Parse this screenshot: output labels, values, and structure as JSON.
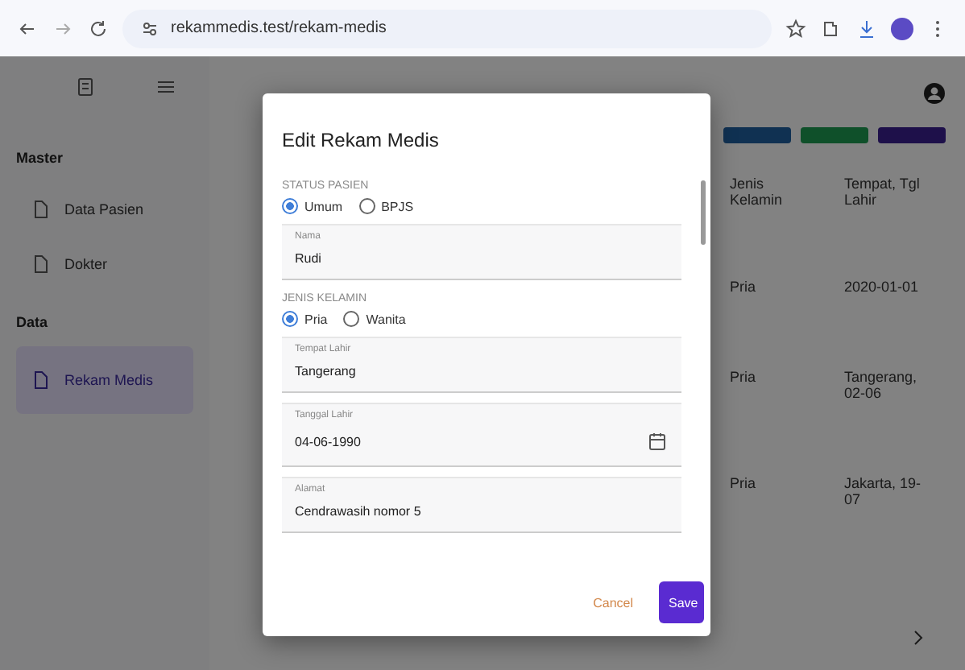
{
  "browser": {
    "url": "rekammedis.test/rekam-medis"
  },
  "sidebar": {
    "sections": [
      {
        "title": "Master",
        "items": [
          {
            "label": "Data Pasien",
            "selected": false
          },
          {
            "label": "Dokter",
            "selected": false
          }
        ]
      },
      {
        "title": "Data",
        "items": [
          {
            "label": "Rekam Medis",
            "selected": true
          }
        ]
      }
    ]
  },
  "table": {
    "columns": [
      "Jenis Kelamin",
      "Tempat, Tgl Lahir"
    ],
    "rows": [
      [
        "Pria",
        "2020-01-01"
      ],
      [
        "Pria",
        "Tangerang, 02-06"
      ],
      [
        "Pria",
        "Jakarta, 19-07"
      ]
    ]
  },
  "dialog": {
    "title": "Edit Rekam Medis",
    "groups": [
      {
        "kind": "radio",
        "label": "STATUS PASIEN",
        "options": [
          {
            "label": "Umum",
            "selected": true
          },
          {
            "label": "BPJS",
            "selected": false
          }
        ]
      },
      {
        "kind": "field",
        "label": "Nama",
        "value": "Rudi"
      },
      {
        "kind": "radio",
        "label": "JENIS KELAMIN",
        "options": [
          {
            "label": "Pria",
            "selected": true
          },
          {
            "label": "Wanita",
            "selected": false
          }
        ]
      },
      {
        "kind": "field",
        "label": "Tempat Lahir",
        "value": "Tangerang"
      },
      {
        "kind": "date",
        "label": "Tanggal Lahir",
        "value": "04-06-1990"
      },
      {
        "kind": "field",
        "label": "Alamat",
        "value": "Cendrawasih nomor 5"
      }
    ],
    "buttons": [
      {
        "label": "Cancel",
        "kind": "text"
      },
      {
        "label": "Save",
        "kind": "primary"
      }
    ]
  }
}
